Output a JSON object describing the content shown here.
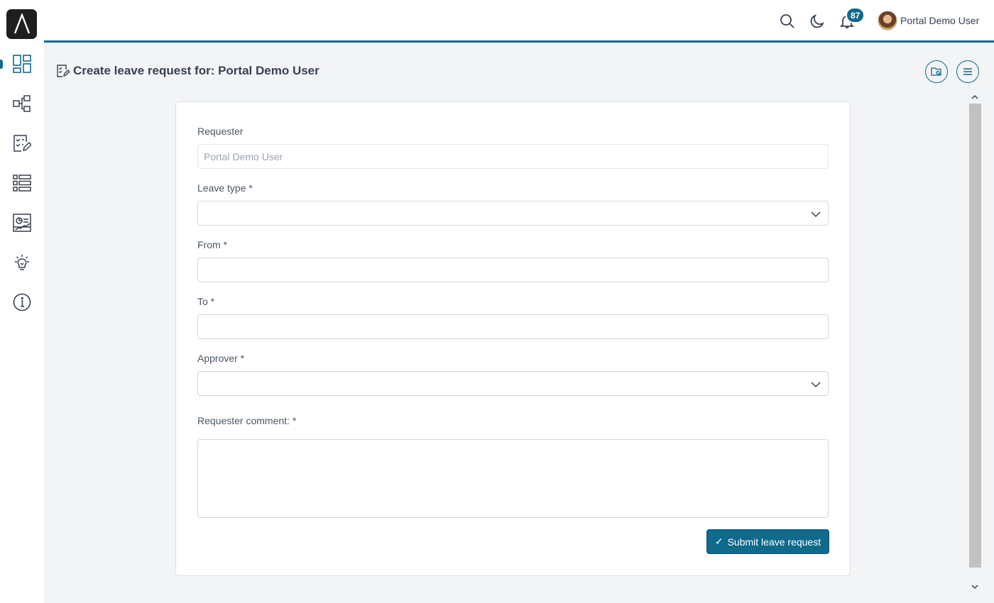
{
  "colors": {
    "accent": "#0f6a8b",
    "sidebar_bg": "#ffffff",
    "page_bg": "#f3f4f6"
  },
  "sidebar": {
    "logo_icon": "portal-logo-icon",
    "items": [
      {
        "name": "dashboard",
        "icon": "dashboard-icon",
        "active": true
      },
      {
        "name": "processes",
        "icon": "process-flow-icon"
      },
      {
        "name": "tasks",
        "icon": "task-checklist-icon"
      },
      {
        "name": "cases",
        "icon": "list-icon"
      },
      {
        "name": "statistics",
        "icon": "chart-icon"
      },
      {
        "name": "ideas",
        "icon": "lightbulb-icon"
      },
      {
        "name": "about",
        "icon": "info-icon"
      }
    ]
  },
  "header": {
    "notifications_count": "87",
    "user_name": "Portal Demo User",
    "icons": [
      "search-icon",
      "moon-icon",
      "bell-icon"
    ]
  },
  "page": {
    "title": "Create leave request for: Portal Demo User",
    "title_icon": "edit-document-icon",
    "actions": [
      "folder-search-icon",
      "menu-icon"
    ]
  },
  "form": {
    "requester_label": "Requester",
    "requester_value": "Portal Demo User",
    "leave_type_label": "Leave type *",
    "leave_type_value": "",
    "from_label": "From *",
    "from_value": "",
    "to_label": "To  *",
    "to_value": "",
    "approver_label": "Approver *",
    "approver_value": "",
    "comment_label": "Requester comment:  *",
    "comment_value": "",
    "submit_label": "Submit leave request",
    "submit_icon": "check-icon"
  }
}
